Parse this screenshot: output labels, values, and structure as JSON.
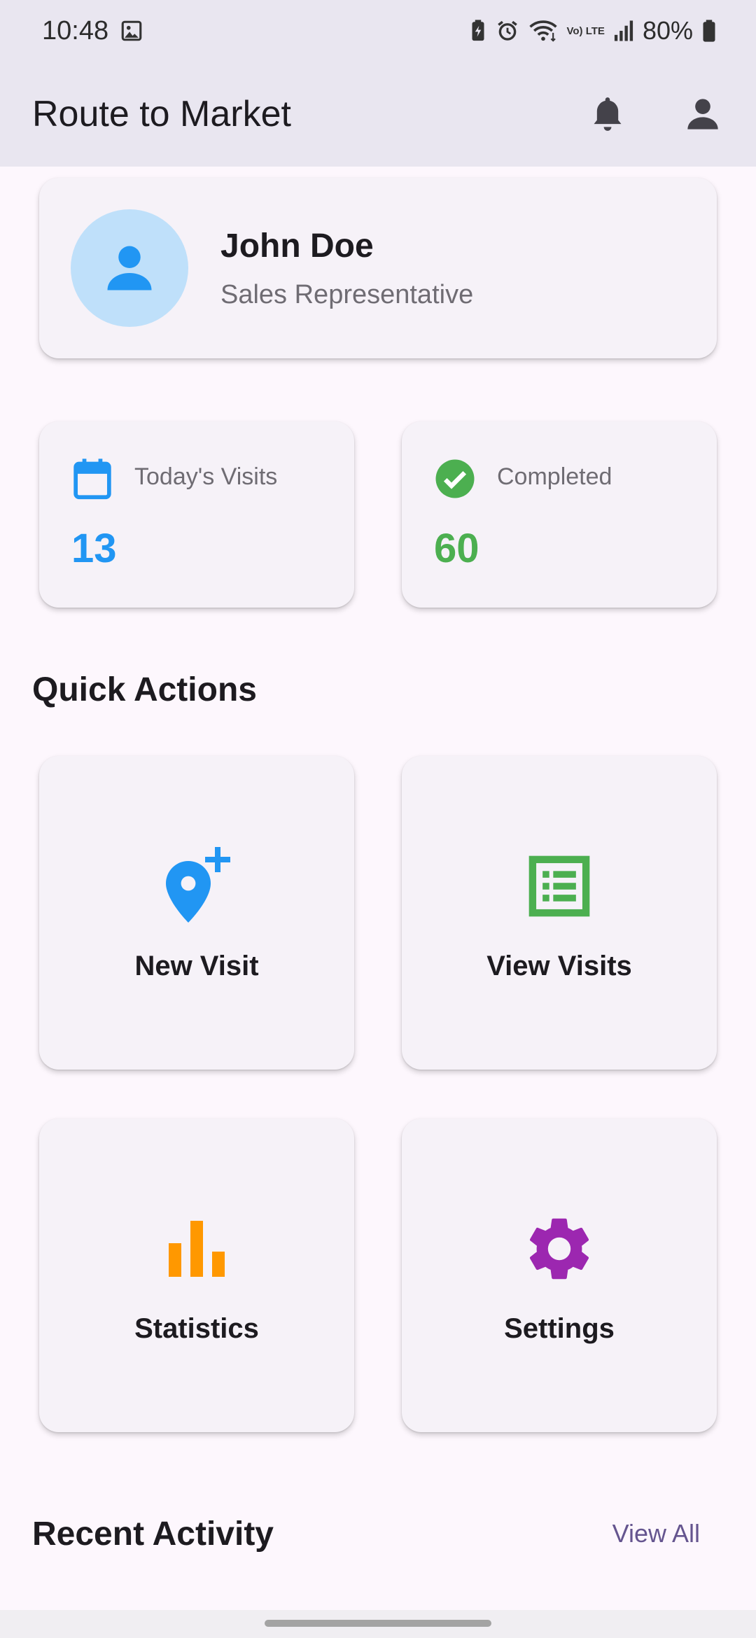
{
  "status_bar": {
    "time": "10:48",
    "battery": "80%",
    "lte_label": "Vo) LTE",
    "icons": [
      "gallery-icon",
      "battery-saver-icon",
      "alarm-icon",
      "wifi-icon",
      "volte-icon",
      "signal-icon",
      "battery-icon"
    ]
  },
  "app_bar": {
    "title": "Route to Market",
    "actions": [
      "notifications-icon",
      "account-icon"
    ]
  },
  "profile": {
    "name": "John Doe",
    "role": "Sales Representative",
    "avatar_icon": "person-icon"
  },
  "stats": [
    {
      "label": "Today's Visits",
      "value": "13",
      "icon": "calendar-icon",
      "color": "#2196f3"
    },
    {
      "label": "Completed",
      "value": "60",
      "icon": "check-circle-icon",
      "color": "#4caf50"
    }
  ],
  "quick_actions": {
    "title": "Quick Actions",
    "items": [
      {
        "label": "New Visit",
        "icon": "add-location-icon",
        "color": "#2196f3"
      },
      {
        "label": "View Visits",
        "icon": "list-alt-icon",
        "color": "#4caf50"
      },
      {
        "label": "Statistics",
        "icon": "bar-chart-icon",
        "color": "#ff9800"
      },
      {
        "label": "Settings",
        "icon": "gear-icon",
        "color": "#9c27b0"
      }
    ]
  },
  "recent_activity": {
    "title": "Recent Activity",
    "view_all_label": "View All"
  },
  "colors": {
    "app_bar_bg": "#e9e6f0",
    "page_bg": "#fdf7fd",
    "card_bg": "#f6f2f8",
    "accent": "#65558f"
  }
}
